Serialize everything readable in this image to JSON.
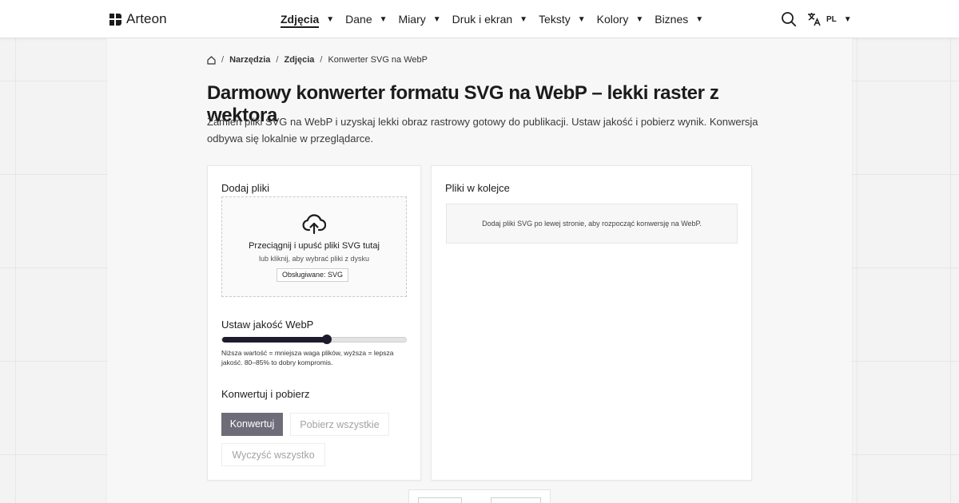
{
  "header": {
    "logo_text": "Arteon",
    "nav": [
      {
        "label": "Zdjęcia",
        "active": true
      },
      {
        "label": "Dane",
        "active": false
      },
      {
        "label": "Miary",
        "active": false
      },
      {
        "label": "Druk i ekran",
        "active": false
      },
      {
        "label": "Teksty",
        "active": false
      },
      {
        "label": "Kolory",
        "active": false
      },
      {
        "label": "Biznes",
        "active": false
      }
    ],
    "language_code": "PL",
    "icons": {
      "search": "search-icon",
      "language": "translate-icon",
      "caret": "caret-down-icon"
    }
  },
  "breadcrumb": {
    "home_icon": "home-icon",
    "items": [
      "Narzędzia",
      "Zdjęcia",
      "Konwerter SVG na WebP"
    ]
  },
  "page": {
    "title": "Darmowy konwerter formatu SVG na WebP – lekki raster z wektora",
    "lead": "Zamień pliki SVG na WebP i uzyskaj lekki obraz rastrowy gotowy do publikacji. Ustaw jakość i pobierz wynik. Konwersja odbywa się lokalnie w przeglądarce."
  },
  "upload": {
    "title": "Dodaj pliki",
    "dropzone_main": "Przeciągnij i upuść pliki SVG tutaj",
    "dropzone_sub": "lub kliknij, aby wybrać pliki z dysku",
    "supported_badge": "Obsługiwane: SVG",
    "icon": "cloud-upload-icon"
  },
  "quality": {
    "title": "Ustaw jakość WebP",
    "value_fraction": 0.57,
    "hint": "Niższa wartość = mniejsza waga plików, wyższa = lepsza jakość. 80–85% to dobry kompromis."
  },
  "actions": {
    "title": "Konwertuj i pobierz",
    "convert_label": "Konwertuj",
    "download_all_label": "Pobierz wszystkie",
    "clear_all_label": "Wyczyść wszystko"
  },
  "queue": {
    "title": "Pliki w kolejce",
    "empty_message": "Dodaj pliki SVG po lewej stronie, aby rozpocząć konwersję na WebP."
  },
  "colors": {
    "accent_dark": "#1e1b2e",
    "button_primary": "#6e6c78",
    "button_disabled_text": "#a3a3a3"
  }
}
